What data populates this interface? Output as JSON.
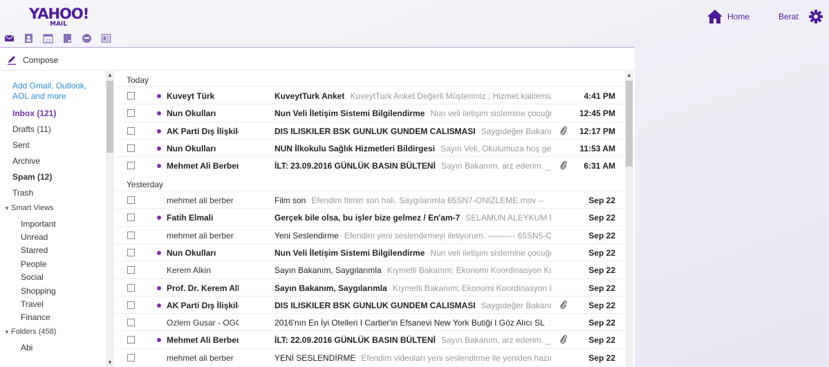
{
  "brand": {
    "logo": "YAHOO!",
    "sub": "MAIL"
  },
  "header": {
    "home_label": "Home",
    "user_name": "Berat"
  },
  "app_icons": [
    "mail-icon",
    "contacts-icon",
    "calendar-icon",
    "notepad-icon",
    "messenger-icon",
    "newsfeed-icon"
  ],
  "calendar_day": "23",
  "compose_label": "Compose",
  "sidebar": {
    "add_accounts": "Add Gmail, Outlook, AOL and more",
    "inbox": "Inbox (121)",
    "drafts": "Drafts (11)",
    "sent": "Sent",
    "archive": "Archive",
    "spam": "Spam (12)",
    "trash": "Trash",
    "smart_views": "Smart Views",
    "smart_items": [
      "Important",
      "Unread",
      "Starred",
      "People",
      "Social",
      "Shopping",
      "Travel",
      "Finance"
    ],
    "folders": "Folders (458)",
    "folder_items": [
      "Abi"
    ]
  },
  "groups": {
    "today": "Today",
    "yesterday": "Yesterday"
  },
  "messages_today": [
    {
      "sender": "Kuveyt Türk",
      "subject": "KuveytTurk Anket",
      "preview": "KuveytTurk Anket Değerli Müşterimiz , Hizmet kalitemizi ar",
      "time": "4:41 PM",
      "unread": true,
      "attachment": false
    },
    {
      "sender": "Nun Okulları",
      "subject": "Nun Veli İletişim Sistemi Bilgilendirme",
      "preview": "Nun veli iletişim sistemine çocuğunuzl",
      "time": "12:45 PM",
      "unread": true,
      "attachment": false
    },
    {
      "sender": "AK Parti Dış İlişkiler",
      "subject": "DIS ILISKILER BSK GUNLUK GUNDEM CALISMASI",
      "preview": "Saygıdeğer Bakanımız; Ekte",
      "time": "12:17 PM",
      "unread": true,
      "attachment": true
    },
    {
      "sender": "Nun Okulları",
      "subject": "NUN İlkokulu Sağlık Hizmetleri Bildirgesi",
      "preview": "Sayın Veli, Okulumuza hoş geldiniz.",
      "time": "11:53 AM",
      "unread": true,
      "attachment": false
    },
    {
      "sender": "Mehmet Ali Berber",
      "subject": "İLT: 23.09.2016 GÜNLÜK BASIN BÜLTENİ",
      "preview": "Sayın Bakanım, arz ederim. ________",
      "time": "6:31 AM",
      "unread": true,
      "attachment": true
    }
  ],
  "messages_yesterday": [
    {
      "sender": "mehmet ali berber",
      "subject": "Film son",
      "preview": "Efendim filmin son hali. Saygılarımla 65SN7-ONIZLEME.mov --",
      "time": "Sep 22",
      "unread": false,
      "attachment": false
    },
    {
      "sender": "Fatih Elmali",
      "subject": "Gerçek bile olsa, bu işler bize gelmez / En'am-7",
      "preview": "SELAMUN ALEYKUM EN'AM",
      "time": "Sep 22",
      "unread": true,
      "attachment": false
    },
    {
      "sender": "mehmet ali berber",
      "subject": "Yeni Seslendirme",
      "preview": "Efendim yeni seslendirmeyi iletiyorum. ---------- 65SN5-ON",
      "time": "Sep 22",
      "unread": false,
      "attachment": false
    },
    {
      "sender": "Nun Okulları",
      "subject": "Nun Veli İletişim Sistemi Bilgilendirme",
      "preview": "Nun veli iletişim sistemine çocuğunuzl",
      "time": "Sep 22",
      "unread": true,
      "attachment": false
    },
    {
      "sender": "Kerem Alkin",
      "subject": "Sayın Bakanım, Saygılarımla",
      "preview": "Kıymetli Bakanım; Ekonomi Koordinasyon Kurulu'n",
      "time": "Sep 22",
      "unread": false,
      "attachment": false
    },
    {
      "sender": "Prof. Dr. Kerem Alkin",
      "subject": "Sayın Bakanım, Saygılarımla",
      "preview": "Kıymetli Bakanım; Ekonomi Koordinasyon Kurulu",
      "time": "Sep 22",
      "unread": true,
      "attachment": false
    },
    {
      "sender": "AK Parti Dış İlişkiler",
      "subject": "DIS ILISKILER BSK GUNLUK GUNDEM CALISMASI",
      "preview": "Saygıdeğer Bakanımız; Ekte",
      "time": "Sep 22",
      "unread": true,
      "attachment": true
    },
    {
      "sender": "Ozlem Gusar - OGC",
      "subject": "2016'nın En İyi Otelleri I Cartier'in Efsanevi New York Butiği I Göz Alıcı SL",
      "preview": "SE",
      "time": "Sep 22",
      "unread": false,
      "attachment": false
    },
    {
      "sender": "Mehmet Ali Berber",
      "subject": "İLT: 22.09.2016 GÜNLÜK BASIN BÜLTENİ",
      "preview": "Sayın Bakanım, arz ederim. ________",
      "time": "Sep 22",
      "unread": true,
      "attachment": true
    },
    {
      "sender": "mehmet ali berber",
      "subject": "YENİ SESLENDİRME",
      "preview": "Efendim videoları yeni seslendirme ile yeniden hazırladık.",
      "time": "Sep 22",
      "unread": false,
      "attachment": false
    }
  ]
}
